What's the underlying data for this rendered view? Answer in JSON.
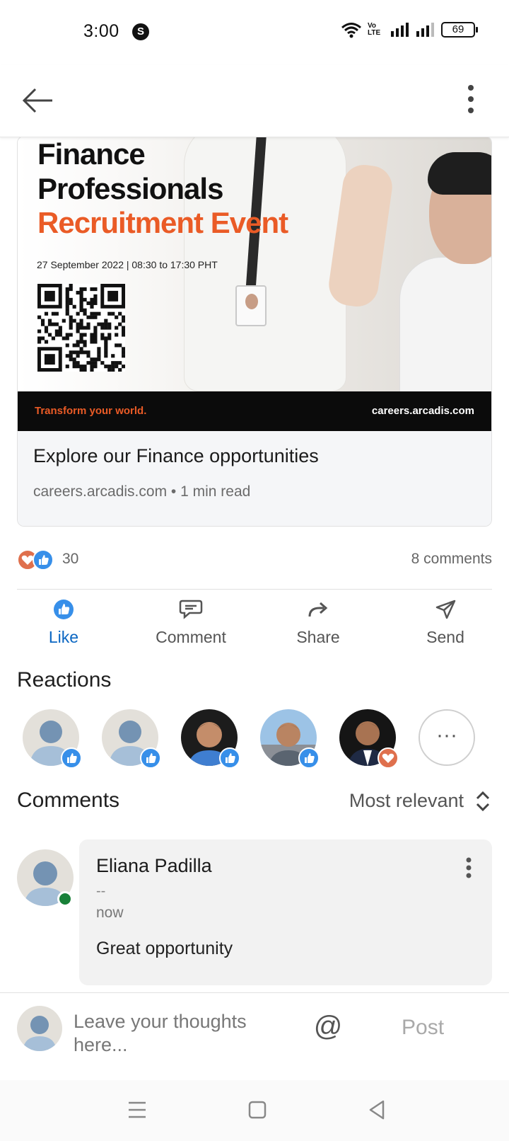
{
  "status_bar": {
    "time": "3:00",
    "app_icon_letter": "S",
    "volte_top": "Vo",
    "volte_bottom": "LTE",
    "battery": "69"
  },
  "article": {
    "banner_title_line1": "Finance",
    "banner_title_line2": "Professionals",
    "banner_subtitle": "Recruitment Event",
    "banner_date": "27 September 2022 | 08:30 to 17:30 PHT",
    "tagline": "Transform your world.",
    "site_url": "careers.arcadis.com",
    "title": "Explore our Finance opportunities",
    "meta": "careers.arcadis.com • 1 min read",
    "brand_color": "#ea5b26"
  },
  "engagement": {
    "reaction_count": "30",
    "comment_count": "8 comments"
  },
  "actions": [
    {
      "label": "Like",
      "icon": "like-icon",
      "active": true
    },
    {
      "label": "Comment",
      "icon": "comment-icon",
      "active": false
    },
    {
      "label": "Share",
      "icon": "share-icon",
      "active": false
    },
    {
      "label": "Send",
      "icon": "send-icon",
      "active": false
    }
  ],
  "reactions": {
    "title": "Reactions",
    "more_label": "···"
  },
  "comments": {
    "title": "Comments",
    "sort_label": "Most relevant",
    "items": [
      {
        "name": "Eliana Padilla",
        "headline": "--",
        "time": "now",
        "text": "Great opportunity"
      }
    ]
  },
  "compose": {
    "placeholder": "Leave your thoughts here...",
    "mention": "@",
    "post_label": "Post"
  },
  "colors": {
    "accent": "#0a66c2",
    "like_blue": "#378fe9",
    "love_red": "#df704d",
    "online_green": "#188038"
  }
}
